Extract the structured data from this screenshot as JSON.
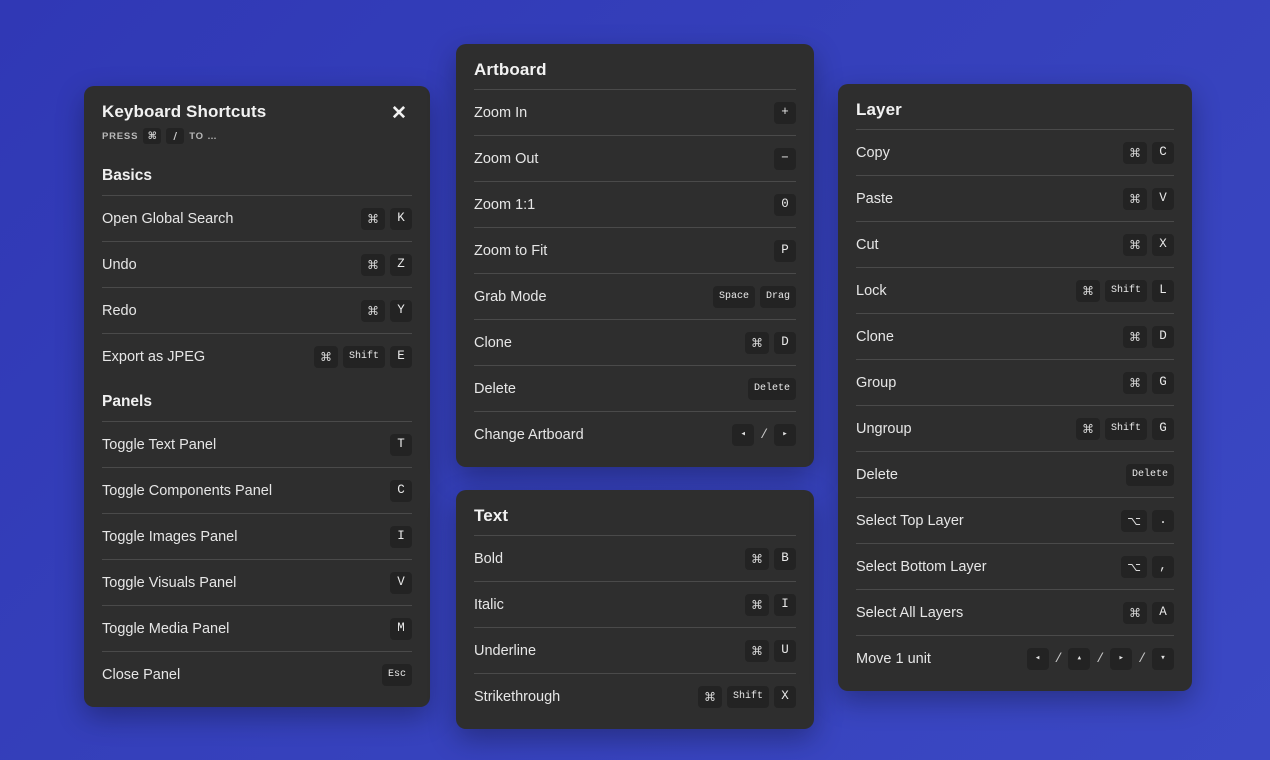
{
  "background": {
    "color_top_left": "#3038b5",
    "color_bottom_right": "#3b48c4"
  },
  "theme": {
    "panel_bg": "#2e2e2e",
    "key_bg": "#232323",
    "divider": "#4a4a4a",
    "text": "#e6e6e6"
  },
  "panels": [
    {
      "id": "shortcuts",
      "title": "Keyboard Shortcuts",
      "close_label": "✕",
      "subtitle": {
        "prefix": "PRESS",
        "key1": "⌘",
        "key2": "/",
        "suffix": "TO …"
      },
      "sections": [
        {
          "heading": "Basics",
          "rows": [
            {
              "label": "Open Global Search",
              "keys": [
                {
                  "text": "⌘",
                  "type": "sym"
                },
                {
                  "text": "K",
                  "type": "char"
                }
              ]
            },
            {
              "label": "Undo",
              "keys": [
                {
                  "text": "⌘",
                  "type": "sym"
                },
                {
                  "text": "Z",
                  "type": "char"
                }
              ]
            },
            {
              "label": "Redo",
              "keys": [
                {
                  "text": "⌘",
                  "type": "sym"
                },
                {
                  "text": "Y",
                  "type": "char"
                }
              ]
            },
            {
              "label": "Export as JPEG",
              "keys": [
                {
                  "text": "⌘",
                  "type": "sym"
                },
                {
                  "text": "Shift",
                  "type": "word"
                },
                {
                  "text": "E",
                  "type": "char"
                }
              ]
            }
          ]
        },
        {
          "heading": "Panels",
          "rows": [
            {
              "label": "Toggle Text Panel",
              "keys": [
                {
                  "text": "T",
                  "type": "char"
                }
              ]
            },
            {
              "label": "Toggle Components Panel",
              "keys": [
                {
                  "text": "C",
                  "type": "char"
                }
              ]
            },
            {
              "label": "Toggle Images Panel",
              "keys": [
                {
                  "text": "I",
                  "type": "char"
                }
              ]
            },
            {
              "label": "Toggle Visuals Panel",
              "keys": [
                {
                  "text": "V",
                  "type": "char"
                }
              ]
            },
            {
              "label": "Toggle Media Panel",
              "keys": [
                {
                  "text": "M",
                  "type": "char"
                }
              ]
            },
            {
              "label": "Close Panel",
              "keys": [
                {
                  "text": "Esc",
                  "type": "word"
                }
              ]
            }
          ]
        }
      ]
    },
    {
      "id": "artboard",
      "title": "Artboard",
      "rows": [
        {
          "label": "Zoom In",
          "keys": [
            {
              "text": "+",
              "type": "char"
            }
          ]
        },
        {
          "label": "Zoom Out",
          "keys": [
            {
              "text": "−",
              "type": "char"
            }
          ]
        },
        {
          "label": "Zoom 1:1",
          "keys": [
            {
              "text": "0",
              "type": "char"
            }
          ]
        },
        {
          "label": "Zoom to Fit",
          "keys": [
            {
              "text": "P",
              "type": "char"
            }
          ]
        },
        {
          "label": "Grab Mode",
          "keys": [
            {
              "text": "Space",
              "type": "word"
            },
            {
              "text": "Drag",
              "type": "word"
            }
          ]
        },
        {
          "label": "Clone",
          "keys": [
            {
              "text": "⌘",
              "type": "sym"
            },
            {
              "text": "D",
              "type": "char"
            }
          ]
        },
        {
          "label": "Delete",
          "keys": [
            {
              "text": "Delete",
              "type": "word"
            }
          ]
        },
        {
          "label": "Change Artboard",
          "keys": [
            {
              "text": "◂",
              "type": "arrow"
            },
            {
              "text": "/",
              "type": "sep"
            },
            {
              "text": "▸",
              "type": "arrow"
            }
          ]
        }
      ]
    },
    {
      "id": "text",
      "title": "Text",
      "rows": [
        {
          "label": "Bold",
          "keys": [
            {
              "text": "⌘",
              "type": "sym"
            },
            {
              "text": "B",
              "type": "char"
            }
          ]
        },
        {
          "label": "Italic",
          "keys": [
            {
              "text": "⌘",
              "type": "sym"
            },
            {
              "text": "I",
              "type": "char"
            }
          ]
        },
        {
          "label": "Underline",
          "keys": [
            {
              "text": "⌘",
              "type": "sym"
            },
            {
              "text": "U",
              "type": "char"
            }
          ]
        },
        {
          "label": "Strikethrough",
          "keys": [
            {
              "text": "⌘",
              "type": "sym"
            },
            {
              "text": "Shift",
              "type": "word"
            },
            {
              "text": "X",
              "type": "char"
            }
          ]
        }
      ]
    },
    {
      "id": "layer",
      "title": "Layer",
      "rows": [
        {
          "label": "Copy",
          "keys": [
            {
              "text": "⌘",
              "type": "sym"
            },
            {
              "text": "C",
              "type": "char"
            }
          ]
        },
        {
          "label": "Paste",
          "keys": [
            {
              "text": "⌘",
              "type": "sym"
            },
            {
              "text": "V",
              "type": "char"
            }
          ]
        },
        {
          "label": "Cut",
          "keys": [
            {
              "text": "⌘",
              "type": "sym"
            },
            {
              "text": "X",
              "type": "char"
            }
          ]
        },
        {
          "label": "Lock",
          "keys": [
            {
              "text": "⌘",
              "type": "sym"
            },
            {
              "text": "Shift",
              "type": "word"
            },
            {
              "text": "L",
              "type": "char"
            }
          ]
        },
        {
          "label": "Clone",
          "keys": [
            {
              "text": "⌘",
              "type": "sym"
            },
            {
              "text": "D",
              "type": "char"
            }
          ]
        },
        {
          "label": "Group",
          "keys": [
            {
              "text": "⌘",
              "type": "sym"
            },
            {
              "text": "G",
              "type": "char"
            }
          ]
        },
        {
          "label": "Ungroup",
          "keys": [
            {
              "text": "⌘",
              "type": "sym"
            },
            {
              "text": "Shift",
              "type": "word"
            },
            {
              "text": "G",
              "type": "char"
            }
          ]
        },
        {
          "label": "Delete",
          "keys": [
            {
              "text": "Delete",
              "type": "word"
            }
          ]
        },
        {
          "label": "Select Top Layer",
          "keys": [
            {
              "text": "⌥",
              "type": "sym"
            },
            {
              "text": ".",
              "type": "char"
            }
          ]
        },
        {
          "label": "Select Bottom Layer",
          "keys": [
            {
              "text": "⌥",
              "type": "sym"
            },
            {
              "text": ",",
              "type": "char"
            }
          ]
        },
        {
          "label": "Select All Layers",
          "keys": [
            {
              "text": "⌘",
              "type": "sym"
            },
            {
              "text": "A",
              "type": "char"
            }
          ]
        },
        {
          "label": "Move 1 unit",
          "keys": [
            {
              "text": "◂",
              "type": "arrow"
            },
            {
              "text": "/",
              "type": "sep"
            },
            {
              "text": "▴",
              "type": "arrow"
            },
            {
              "text": "/",
              "type": "sep"
            },
            {
              "text": "▸",
              "type": "arrow"
            },
            {
              "text": "/",
              "type": "sep"
            },
            {
              "text": "▾",
              "type": "arrow"
            }
          ]
        }
      ]
    }
  ]
}
